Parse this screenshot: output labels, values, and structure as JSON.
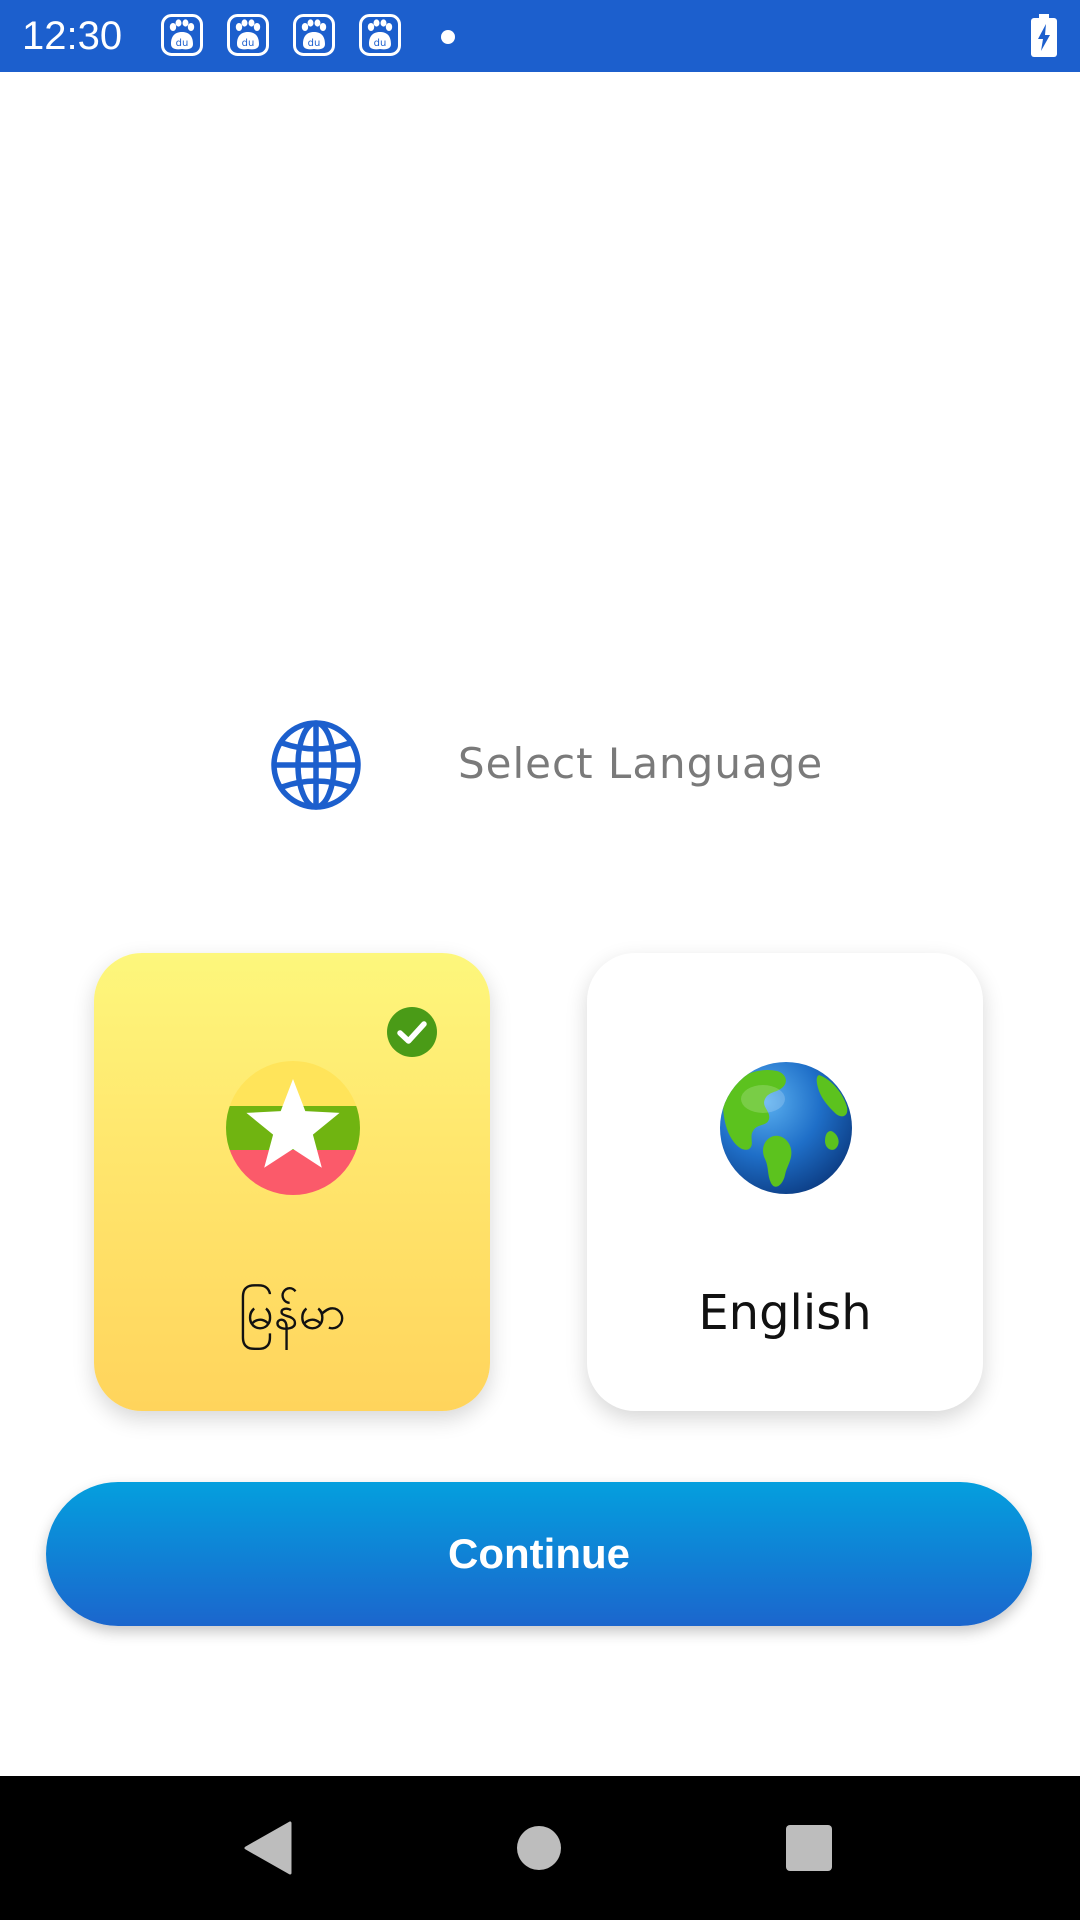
{
  "status_bar": {
    "time": "12:30",
    "notification_icons": [
      "baidu-paw-icon",
      "baidu-paw-icon",
      "baidu-paw-icon",
      "baidu-paw-icon"
    ],
    "notification_icon_text": "du",
    "icon_color": "#ffffff",
    "background": "#1c5fcd"
  },
  "header": {
    "icon": "globe-grid-icon",
    "title": "Select Language"
  },
  "languages": [
    {
      "label": "မြန်မာ",
      "icon": "myanmar-flag-icon",
      "selected": true
    },
    {
      "label": "English",
      "icon": "earth-globe-icon",
      "selected": false
    }
  ],
  "continue_button": {
    "label": "Continue"
  },
  "colors": {
    "accent_blue": "#1b66cd",
    "button_gradient_top": "#049fde",
    "selected_card_top": "#fdf77c",
    "selected_card_bottom": "#ffd45c",
    "check_green": "#4a9b17",
    "title_gray": "#7a7a7a"
  },
  "nav_bar": {
    "icons": [
      "back-icon",
      "home-icon",
      "recents-icon"
    ]
  }
}
